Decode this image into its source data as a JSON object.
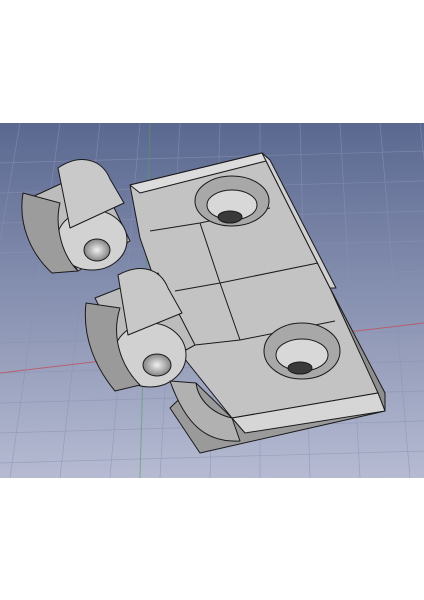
{
  "viewport": {
    "name": "3d-cad-viewport",
    "background_top": "#5a6890",
    "background_bottom": "#b4b9d0",
    "grid_color": "#8a92b5"
  },
  "model": {
    "name": "hinge-part",
    "face_light": "#d8d8d8",
    "face_mid": "#bfbfbf",
    "face_dark": "#8e8e8e",
    "edge_color": "#1a1a1a"
  }
}
